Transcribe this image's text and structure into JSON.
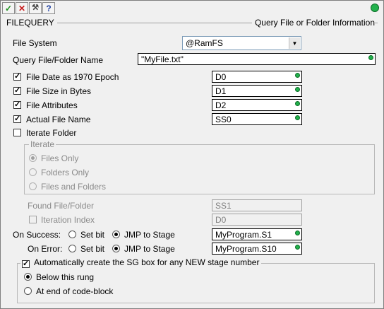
{
  "toolbar": {
    "buttons": [
      {
        "icon": "check-icon",
        "glyph": "✓",
        "color": "#1a8f1a"
      },
      {
        "icon": "cancel-icon",
        "glyph": "✕",
        "color": "#c81e1e"
      },
      {
        "icon": "wrench-icon",
        "glyph": "⚒",
        "color": "#444444"
      },
      {
        "icon": "help-icon",
        "glyph": "?",
        "color": "#1e3fa0"
      }
    ],
    "status_color": "#22b14c"
  },
  "header": {
    "instruction": "FILEQUERY",
    "description": "Query File or Folder Information"
  },
  "file_system": {
    "label": "File System",
    "value": "@RamFS"
  },
  "query_name": {
    "label": "Query File/Folder Name",
    "value": "\"MyFile.txt\""
  },
  "outputs": [
    {
      "label": "File Date as 1970 Epoch",
      "checked": true,
      "value": "D0"
    },
    {
      "label": "File Size in Bytes",
      "checked": true,
      "value": "D1"
    },
    {
      "label": "File Attributes",
      "checked": true,
      "value": "D2"
    },
    {
      "label": "Actual File Name",
      "checked": true,
      "value": "SS0"
    }
  ],
  "iterate_folder": {
    "label": "Iterate Folder",
    "checked": false
  },
  "iterate_group": {
    "title": "Iterate",
    "options": [
      "Files Only",
      "Folders Only",
      "Files and Folders"
    ],
    "selected": 0
  },
  "found": {
    "label": "Found File/Folder",
    "value": "SS1"
  },
  "iteration_index": {
    "label": "Iteration Index",
    "value": "D0",
    "checked": false
  },
  "on_success": {
    "label": "On Success:",
    "opt1": "Set bit",
    "opt2": "JMP to Stage",
    "selected": 2,
    "value": "MyProgram.S1"
  },
  "on_error": {
    "label": "On Error:",
    "opt1": "Set bit",
    "opt2": "JMP to Stage",
    "selected": 2,
    "value": "MyProgram.S10"
  },
  "sg_box": {
    "label": "Automatically create the SG box for any NEW stage number",
    "checked": true,
    "options": [
      "Below this rung",
      "At end of code-block"
    ],
    "selected": 0
  }
}
